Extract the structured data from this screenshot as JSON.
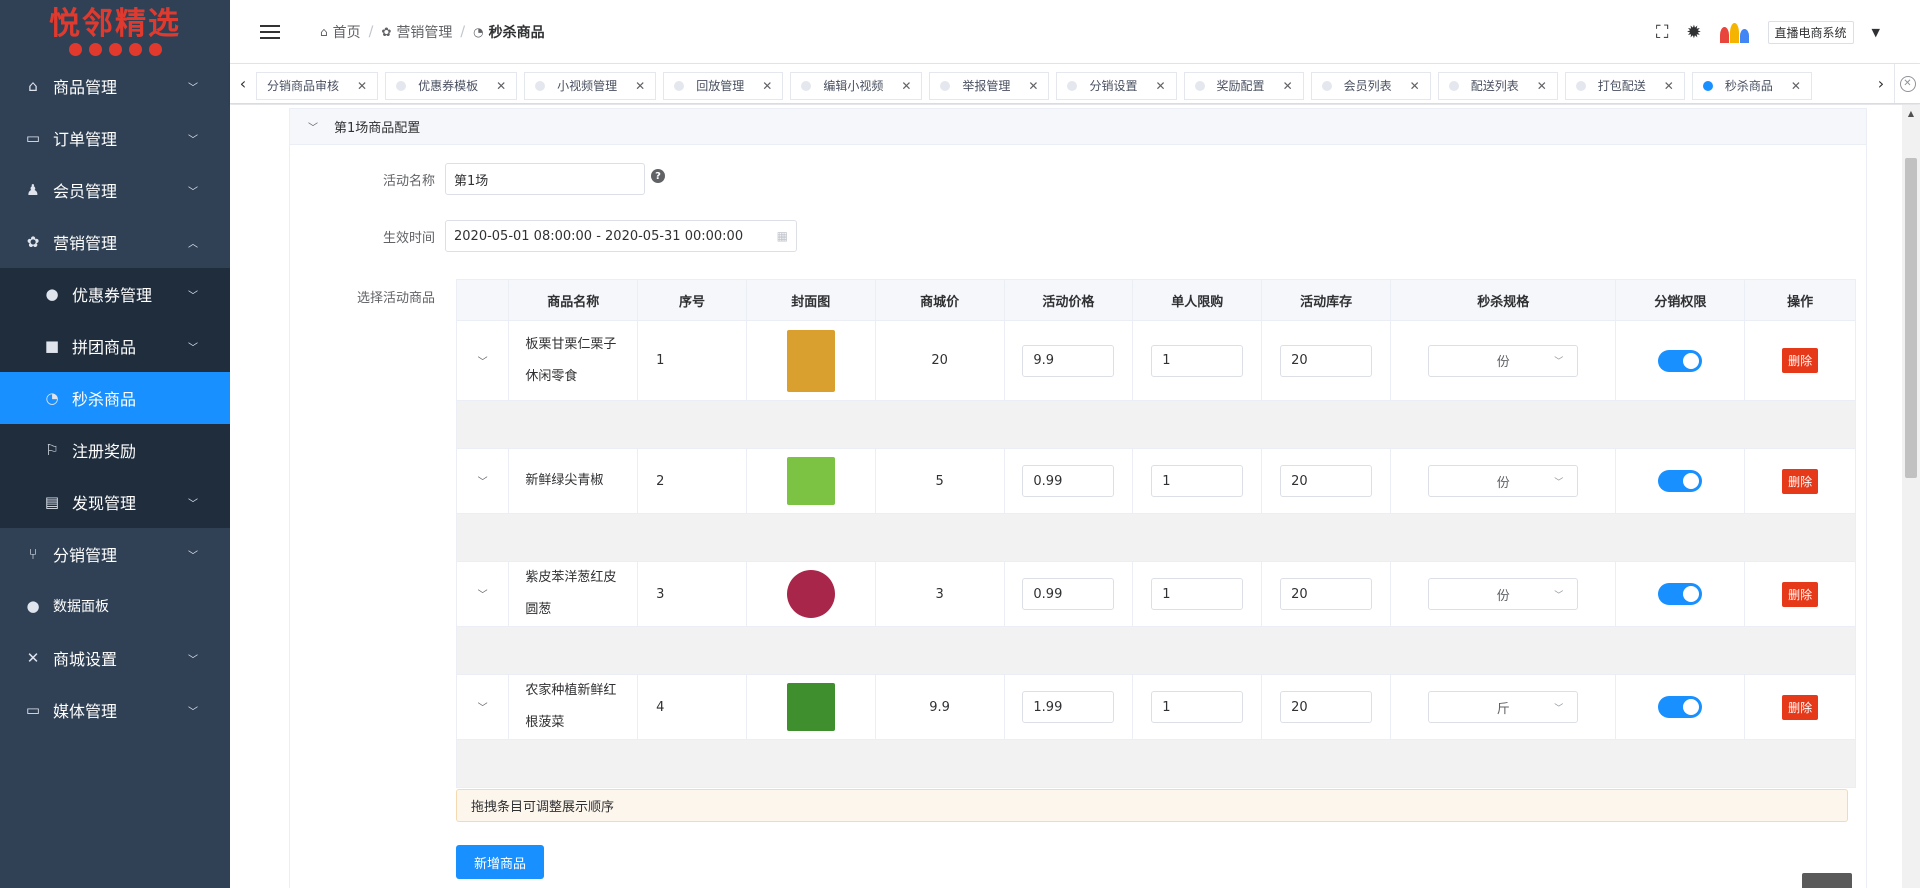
{
  "logo": {
    "text": "悦邻精选"
  },
  "sidebar": {
    "items": [
      {
        "label": "商品管理",
        "icon": "basket-icon",
        "glyph": "⌂"
      },
      {
        "label": "订单管理",
        "icon": "keyboard-icon",
        "glyph": "▭"
      },
      {
        "label": "会员管理",
        "icon": "user-add-icon",
        "glyph": "♟"
      },
      {
        "label": "营销管理",
        "icon": "palette-icon",
        "glyph": "✿"
      }
    ],
    "sub_items": [
      {
        "label": "优惠券管理",
        "icon": "bulb-icon",
        "glyph": "●"
      },
      {
        "label": "拼团商品",
        "icon": "briefcase-icon",
        "glyph": "■"
      },
      {
        "label": "秒杀商品",
        "icon": "timer-icon",
        "glyph": "◔"
      },
      {
        "label": "注册奖励",
        "icon": "award-icon",
        "glyph": "⚐"
      },
      {
        "label": "发现管理",
        "icon": "chat-icon",
        "glyph": "▤"
      }
    ],
    "bottom_items": [
      {
        "label": "分销管理",
        "icon": "branch-icon",
        "glyph": "⑂"
      },
      {
        "label": "数据面板",
        "icon": "circle-icon",
        "glyph": "●"
      },
      {
        "label": "商城设置",
        "icon": "tools-icon",
        "glyph": "✕"
      },
      {
        "label": "媒体管理",
        "icon": "monitor-icon",
        "glyph": "▭"
      }
    ]
  },
  "header": {
    "breadcrumb": [
      "首页",
      "营销管理",
      "秒杀商品"
    ],
    "system_name": "直播电商系统"
  },
  "tags": [
    "分销商品审核",
    "优惠券模板",
    "小视频管理",
    "回放管理",
    "编辑小视频",
    "举报管理",
    "分销设置",
    "奖励配置",
    "会员列表",
    "配送列表",
    "打包配送",
    "秒杀商品"
  ],
  "panel": {
    "title": "第1场商品配置",
    "name_label": "活动名称",
    "name_value": "第1场",
    "time_label": "生效时间",
    "time_value": "2020-05-01 08:00:00 - 2020-05-31 00:00:00",
    "goods_label": "选择活动商品"
  },
  "table": {
    "headers": [
      "",
      "商品名称",
      "序号",
      "封面图",
      "商城价",
      "活动价格",
      "单人限购",
      "活动库存",
      "秒杀规格",
      "分销权限",
      "操作"
    ],
    "rows": [
      {
        "name": "板栗甘栗仁栗子休闲零食",
        "seq": "1",
        "price": "20",
        "act_price": "9.9",
        "limit": "1",
        "stock": "20",
        "spec": "份",
        "delete": "删除",
        "thumb_color": "#d9a030"
      },
      {
        "name": "新鲜绿尖青椒",
        "seq": "2",
        "price": "5",
        "act_price": "0.99",
        "limit": "1",
        "stock": "20",
        "spec": "份",
        "delete": "删除",
        "thumb_color": "#7cc243"
      },
      {
        "name": "紫皮苯洋葱红皮圆葱",
        "seq": "3",
        "price": "3",
        "act_price": "0.99",
        "limit": "1",
        "stock": "20",
        "spec": "份",
        "delete": "删除",
        "thumb_color": "#a8264a"
      },
      {
        "name": "农家种植新鲜红根菠菜",
        "seq": "4",
        "price": "9.9",
        "act_price": "1.99",
        "limit": "1",
        "stock": "20",
        "spec": "斤",
        "delete": "删除",
        "thumb_color": "#3f8f2e"
      }
    ]
  },
  "tip": "拖拽条目可调整展示顺序",
  "add_button": "新增商品",
  "colors": {
    "primary": "#1890ff",
    "danger": "#e6391a",
    "sidebar": "#304156",
    "brand": "#e03a2f"
  }
}
